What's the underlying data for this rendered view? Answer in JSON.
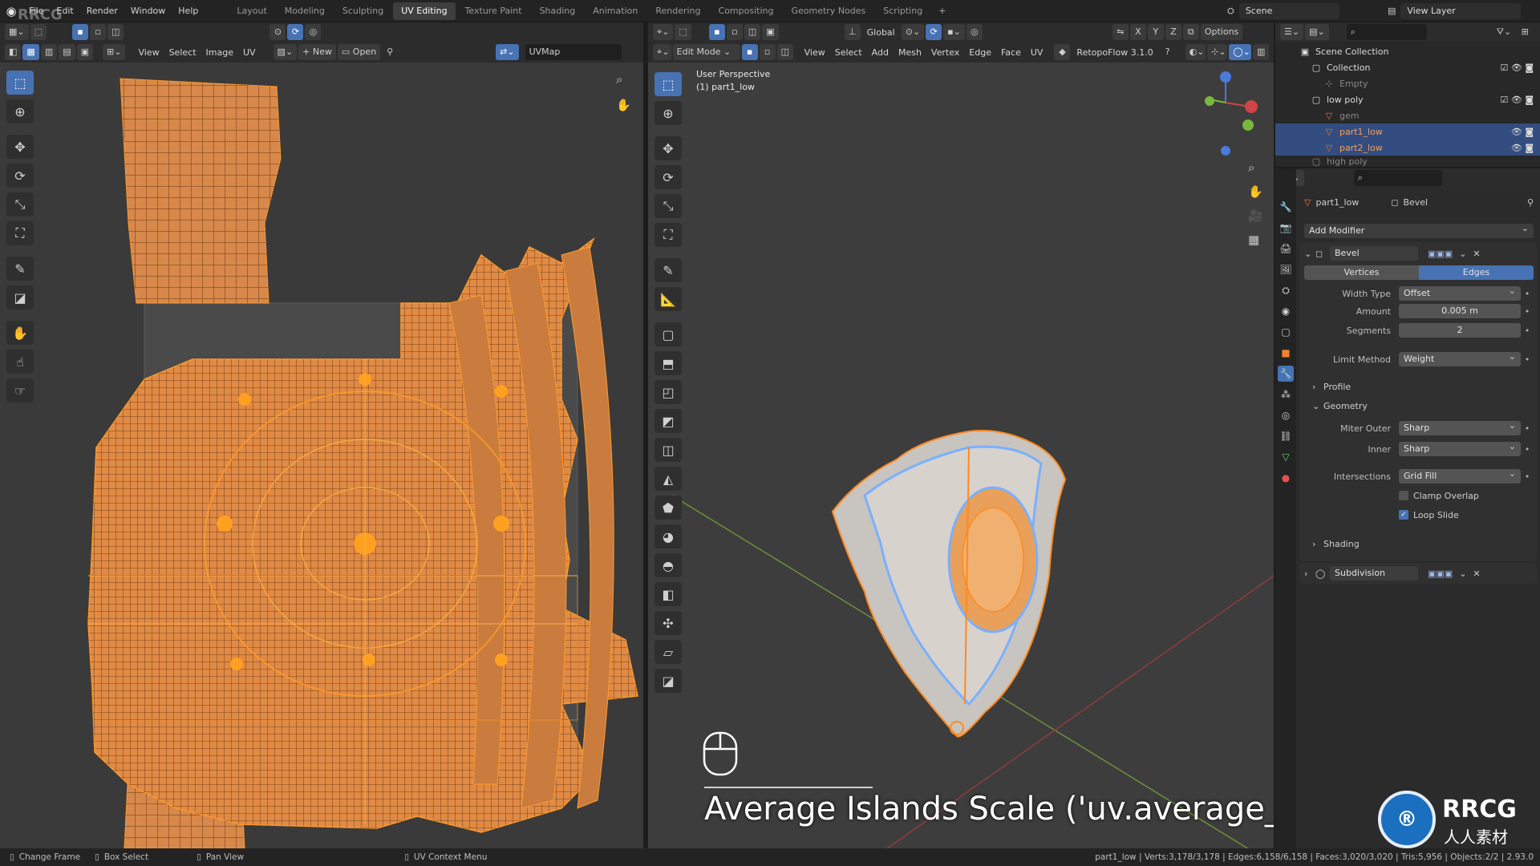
{
  "app": {
    "menus": [
      "File",
      "Edit",
      "Render",
      "Window",
      "Help"
    ],
    "workspaces": [
      "Layout",
      "Modeling",
      "Sculpting",
      "UV Editing",
      "Texture Paint",
      "Shading",
      "Animation",
      "Rendering",
      "Compositing",
      "Geometry Nodes",
      "Scripting"
    ],
    "active_workspace": "UV Editing",
    "scene": "Scene",
    "view_layer": "View Layer",
    "watermark_logo_text": "RRCG"
  },
  "uv_editor": {
    "menus": [
      "View",
      "Select",
      "Image",
      "UV"
    ],
    "new_label": "New",
    "open_label": "Open",
    "uvmap": "UVMap"
  },
  "viewport": {
    "mode": "Edit Mode",
    "menus": [
      "View",
      "Select",
      "Add",
      "Mesh",
      "Vertex",
      "Edge",
      "Face",
      "UV"
    ],
    "addon": "RetopoFlow 3.1.0",
    "transform": "Global",
    "options_label": "Options",
    "perspective": "User Perspective",
    "object_label": "(1) part1_low",
    "caption": "Average Islands Scale ('uv.average_"
  },
  "outliner": {
    "rows": [
      {
        "label": "Scene Collection"
      },
      {
        "label": "Collection"
      },
      {
        "label": "Empty"
      },
      {
        "label": "low poly"
      },
      {
        "label": "gem"
      },
      {
        "label": "part1_low"
      },
      {
        "label": "part2_low"
      },
      {
        "label": "high poly"
      }
    ]
  },
  "properties": {
    "object": "part1_low",
    "modifier_tab": "Bevel",
    "add_modifier": "Add Modifier",
    "modifier_name": "Bevel",
    "affect_vertices": "Vertices",
    "affect_edges": "Edges",
    "width_type_label": "Width Type",
    "width_type_value": "Offset",
    "amount_label": "Amount",
    "amount_value": "0.005 m",
    "segments_label": "Segments",
    "segments_value": "2",
    "limit_method_label": "Limit Method",
    "limit_method_value": "Weight",
    "profile_label": "Profile",
    "geometry_label": "Geometry",
    "miter_outer_label": "Miter Outer",
    "miter_outer_value": "Sharp",
    "inner_label": "Inner",
    "inner_value": "Sharp",
    "intersections_label": "Intersections",
    "intersections_value": "Grid Fill",
    "clamp_overlap": "Clamp Overlap",
    "loop_slide": "Loop Slide",
    "shading_label": "Shading",
    "subdivision_name": "Subdivision"
  },
  "statusbar": {
    "change_frame": "Change Frame",
    "box_select": "Box Select",
    "pan_view": "Pan View",
    "uv_context": "UV Context Menu",
    "stats": "part1_low | Verts:3,178/3,178 | Edges:6,158/6,158 | Faces:3,020/3,020 | Tris:5,956 | Objects:2/2 | 2.93.0"
  },
  "branding": {
    "logo_top": "RRCG",
    "logo_bottom": "人人素材"
  }
}
